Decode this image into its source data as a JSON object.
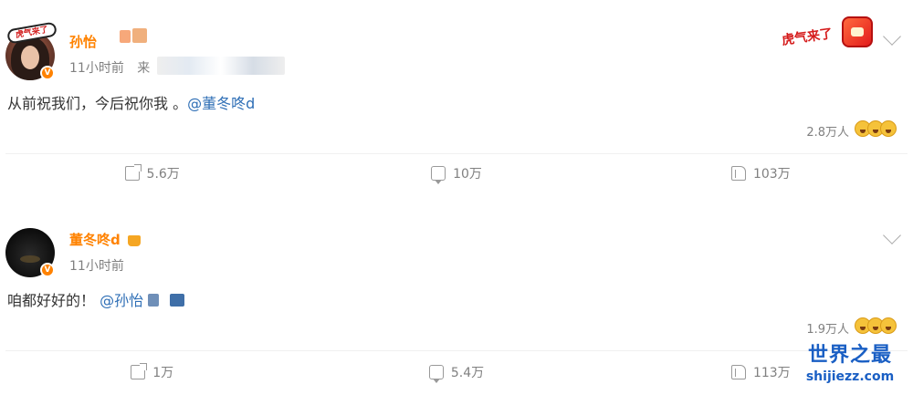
{
  "posts": [
    {
      "username": "孙怡",
      "timestamp": "11小时前",
      "source_prefix": "来",
      "content_text": "从前祝我们，今后祝你我 。",
      "mention": "@董冬咚d",
      "reaction_count": "2.8万人",
      "actions": {
        "share": "5.6万",
        "comment": "10万",
        "like": "103万"
      },
      "avatar_sticker": "虎气来了",
      "header_sticker": "虎气来了"
    },
    {
      "username": "董冬咚d",
      "timestamp": "11小时前",
      "content_text": "咱都好好的！",
      "mention": "@孙怡",
      "reaction_count": "1.9万人",
      "actions": {
        "share": "1万",
        "comment": "5.4万",
        "like": "113万"
      }
    }
  ],
  "watermark": {
    "cn": "世界之最",
    "en": "shijiezz.com"
  },
  "colors": {
    "username": "#ff8200",
    "mention_orange": "#eb7350",
    "mention_blue": "#2f6fb6",
    "meta": "#808080",
    "verified": "#ff8200",
    "watermark": "#1a5fc4"
  }
}
